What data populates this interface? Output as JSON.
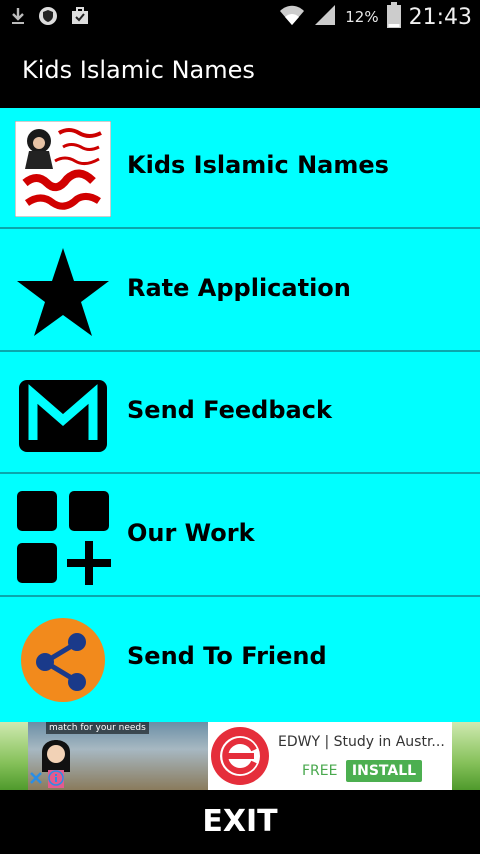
{
  "status_bar": {
    "battery_percent": "12%",
    "time": "21:43",
    "icons": [
      "download-icon",
      "shield-icon",
      "briefcase-icon",
      "wifi-icon",
      "signal-icon",
      "battery-icon"
    ]
  },
  "app": {
    "title": "Kids Islamic Names"
  },
  "menu": {
    "background_color": "#00FFFF",
    "items": [
      {
        "label": "Kids Islamic Names",
        "icon": "app-logo-icon"
      },
      {
        "label": "Rate Application",
        "icon": "star-icon"
      },
      {
        "label": "Send Feedback",
        "icon": "mail-icon"
      },
      {
        "label": "Our Work",
        "icon": "apps-add-icon"
      },
      {
        "label": "Send To Friend",
        "icon": "share-icon"
      }
    ]
  },
  "ad": {
    "image_caption": "match for your needs",
    "title": "EDWY | Study in Austr...",
    "price_label": "FREE",
    "install_label": "INSTALL"
  },
  "footer": {
    "exit_label": "EXIT"
  }
}
